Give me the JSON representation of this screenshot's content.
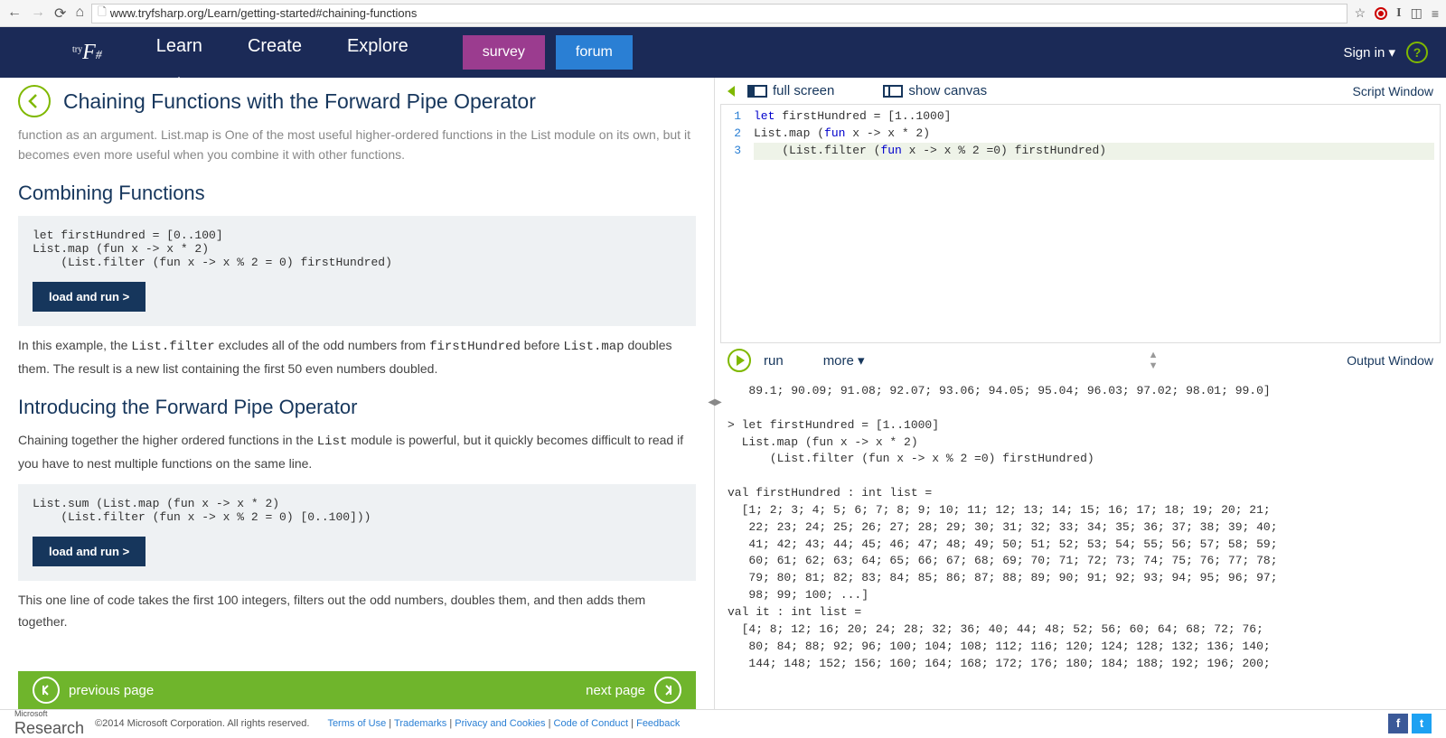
{
  "browser": {
    "url": "www.tryfsharp.org/Learn/getting-started#chaining-functions"
  },
  "header": {
    "logo_prefix": "try",
    "logo_main": "F#",
    "nav": [
      "Learn",
      "Create",
      "Explore"
    ],
    "active_nav": "Learn",
    "survey_btn": "survey",
    "forum_btn": "forum",
    "signin": "Sign in ▾",
    "help": "?"
  },
  "left": {
    "title": "Chaining Functions with the Forward Pipe Operator",
    "cutoff_line": "function as an argument. List.map is One of the most useful higher-ordered functions in the List module on its own, but it becomes even more useful when you combine it with other functions.",
    "h2_1": "Combining Functions",
    "code1": "let firstHundred = [0..100]\nList.map (fun x -> x * 2)\n    (List.filter (fun x -> x % 2 = 0) firstHundred)",
    "load_run": "load and run >",
    "para1a": "In this example, the ",
    "para1b": " excludes all of the odd numbers from ",
    "para1c": " before ",
    "para1d": " doubles them. The result is a new list containing the first 50 even numbers doubled.",
    "code_listfilter": "List.filter",
    "code_firsthundred": "firstHundred",
    "code_listmap": "List.map",
    "h2_2": "Introducing the Forward Pipe Operator",
    "para2a": "Chaining together the higher ordered functions in the ",
    "para2b": " module is powerful, but it quickly becomes difficult to read if you have to nest multiple functions on the same line.",
    "code_list": "List",
    "code2": "List.sum (List.map (fun x -> x * 2)\n    (List.filter (fun x -> x % 2 = 0) [0..100]))",
    "para3": "This one line of code takes the first 100 integers, filters out the odd numbers, doubles them, and then adds them together.",
    "prev": "previous page",
    "next": "next page"
  },
  "right": {
    "fullscreen": "full screen",
    "showcanvas": "show canvas",
    "script_window": "Script Window",
    "editor_lines": [
      "1",
      "2",
      "3"
    ],
    "editor_code_1": "let firstHundred = [1..1000]",
    "editor_code_2": "List.map (fun x -> x * 2)",
    "editor_code_3": "    (List.filter (fun x -> x % 2 =0) firstHundred)",
    "run": "run",
    "more": "more ▾",
    "output_window": "Output Window",
    "output": "   89.1; 90.09; 91.08; 92.07; 93.06; 94.05; 95.04; 96.03; 97.02; 98.01; 99.0]\n\n> let firstHundred = [1..1000]\n  List.map (fun x -> x * 2)\n      (List.filter (fun x -> x % 2 =0) firstHundred)\n\nval firstHundred : int list =\n  [1; 2; 3; 4; 5; 6; 7; 8; 9; 10; 11; 12; 13; 14; 15; 16; 17; 18; 19; 20; 21;\n   22; 23; 24; 25; 26; 27; 28; 29; 30; 31; 32; 33; 34; 35; 36; 37; 38; 39; 40;\n   41; 42; 43; 44; 45; 46; 47; 48; 49; 50; 51; 52; 53; 54; 55; 56; 57; 58; 59;\n   60; 61; 62; 63; 64; 65; 66; 67; 68; 69; 70; 71; 72; 73; 74; 75; 76; 77; 78;\n   79; 80; 81; 82; 83; 84; 85; 86; 87; 88; 89; 90; 91; 92; 93; 94; 95; 96; 97;\n   98; 99; 100; ...]\nval it : int list =\n  [4; 8; 12; 16; 20; 24; 28; 32; 36; 40; 44; 48; 52; 56; 60; 64; 68; 72; 76;\n   80; 84; 88; 92; 96; 100; 104; 108; 112; 116; 120; 124; 128; 132; 136; 140;\n   144; 148; 152; 156; 160; 164; 168; 172; 176; 180; 184; 188; 192; 196; 200;"
  },
  "footer": {
    "copyright": "©2014 Microsoft Corporation. All rights reserved.",
    "links": [
      "Terms of Use",
      "Trademarks",
      "Privacy and Cookies",
      "Code of Conduct",
      "Feedback"
    ]
  }
}
